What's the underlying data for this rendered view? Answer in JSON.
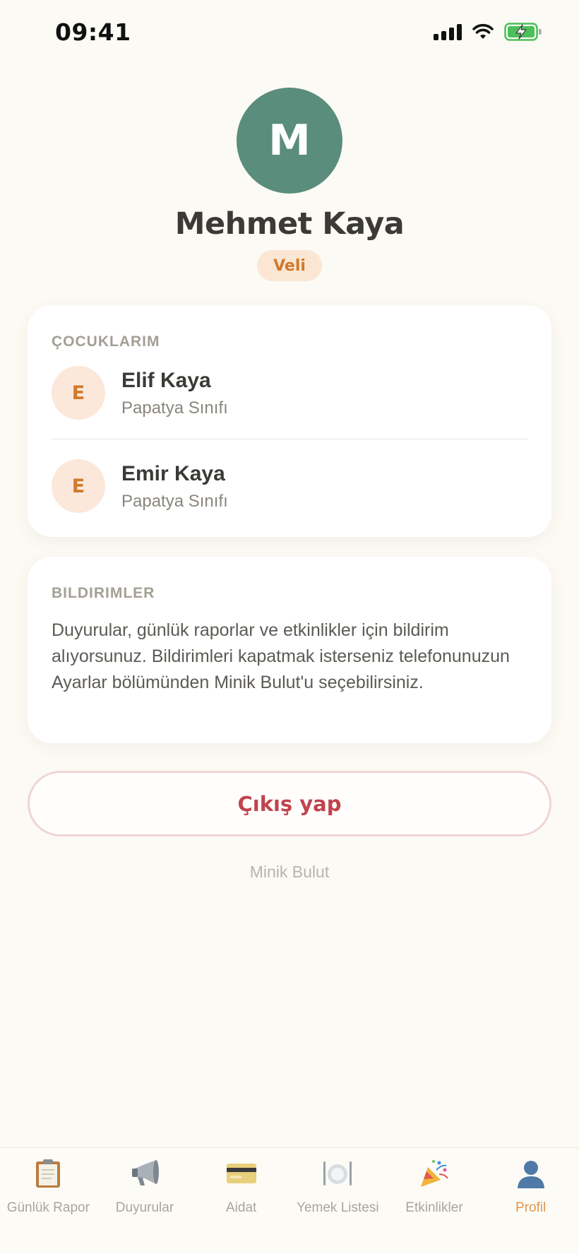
{
  "status_bar": {
    "time": "09:41"
  },
  "profile": {
    "avatar_initial": "M",
    "name": "Mehmet Kaya",
    "role": "Veli"
  },
  "children_section": {
    "heading": "ÇOCUKLARIM",
    "children": [
      {
        "initial": "E",
        "name": "Elif Kaya",
        "class": "Papatya Sınıfı"
      },
      {
        "initial": "E",
        "name": "Emir Kaya",
        "class": "Papatya Sınıfı"
      }
    ]
  },
  "notifications_section": {
    "heading": "BILDIRIMLER",
    "text": "Duyurular, günlük raporlar ve etkinlikler için bildirim alıyorsunuz. Bildirimleri kapatmak isterseniz telefonunuzun Ayarlar bölümünden Minik Bulut'u seçebilirsiniz."
  },
  "logout": {
    "label": "Çıkış yap"
  },
  "footer": {
    "app_name": "Minik Bulut"
  },
  "tab_bar": {
    "tabs": [
      {
        "label": "Günlük Rapor",
        "icon": "clipboard-icon",
        "active": false
      },
      {
        "label": "Duyurular",
        "icon": "megaphone-icon",
        "active": false
      },
      {
        "label": "Aidat",
        "icon": "credit-card-icon",
        "active": false
      },
      {
        "label": "Yemek Listesi",
        "icon": "plate-icon",
        "active": false
      },
      {
        "label": "Etkinlikler",
        "icon": "party-popper-icon",
        "active": false
      },
      {
        "label": "Profil",
        "icon": "person-icon",
        "active": true
      }
    ]
  },
  "colors": {
    "background": "#fcfaf4",
    "avatar": "#5a8d7b",
    "accent_orange": "#cf7a2c",
    "active_tab": "#e1964f",
    "logout_red": "#c0434e"
  }
}
